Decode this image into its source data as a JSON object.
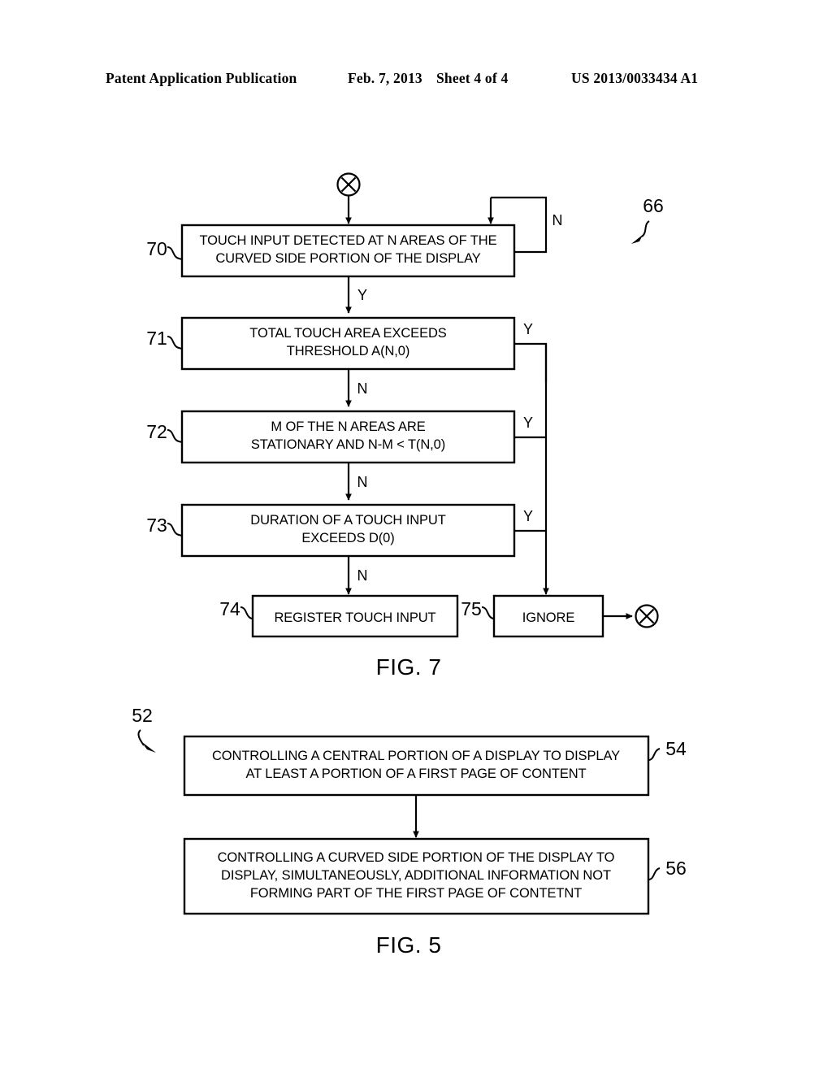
{
  "header": {
    "publication": "Patent Application Publication",
    "date": "Feb. 7, 2013",
    "sheet": "Sheet 4 of 4",
    "number": "US 2013/0033434 A1"
  },
  "figures": [
    {
      "caption": "FIG. 7",
      "figure_ref": "66",
      "entry_connector": "X",
      "exit_connector": "X",
      "steps": [
        {
          "ref": "70",
          "lines": [
            "TOUCH INPUT DETECTED AT N AREAS OF THE",
            "CURVED SIDE PORTION OF THE DISPLAY"
          ],
          "no_branch": "N",
          "yes_branch": "Y"
        },
        {
          "ref": "71",
          "lines": [
            "TOTAL TOUCH AREA EXCEEDS",
            "THRESHOLD A(N,0)"
          ],
          "no_branch": "N",
          "yes_branch": "Y"
        },
        {
          "ref": "72",
          "lines": [
            "M OF THE N AREAS ARE",
            "STATIONARY AND N-M < T(N,0)"
          ],
          "no_branch": "N",
          "yes_branch": "Y"
        },
        {
          "ref": "73",
          "lines": [
            "DURATION OF A TOUCH INPUT",
            "EXCEEDS D(0)"
          ],
          "no_branch": "N",
          "yes_branch": "Y"
        },
        {
          "ref": "74",
          "lines": [
            "REGISTER TOUCH INPUT"
          ]
        },
        {
          "ref": "75",
          "lines": [
            "IGNORE"
          ]
        }
      ]
    },
    {
      "caption": "FIG. 5",
      "figure_ref": "52",
      "steps": [
        {
          "ref": "54",
          "lines": [
            "CONTROLLING A CENTRAL PORTION OF A DISPLAY TO DISPLAY",
            "AT LEAST A PORTION OF A FIRST PAGE OF CONTENT"
          ]
        },
        {
          "ref": "56",
          "lines": [
            "CONTROLLING A CURVED SIDE PORTION OF THE DISPLAY TO",
            "DISPLAY, SIMULTANEOUSLY, ADDITIONAL INFORMATION NOT",
            "FORMING PART OF THE FIRST PAGE OF CONTETNT"
          ]
        }
      ]
    }
  ]
}
